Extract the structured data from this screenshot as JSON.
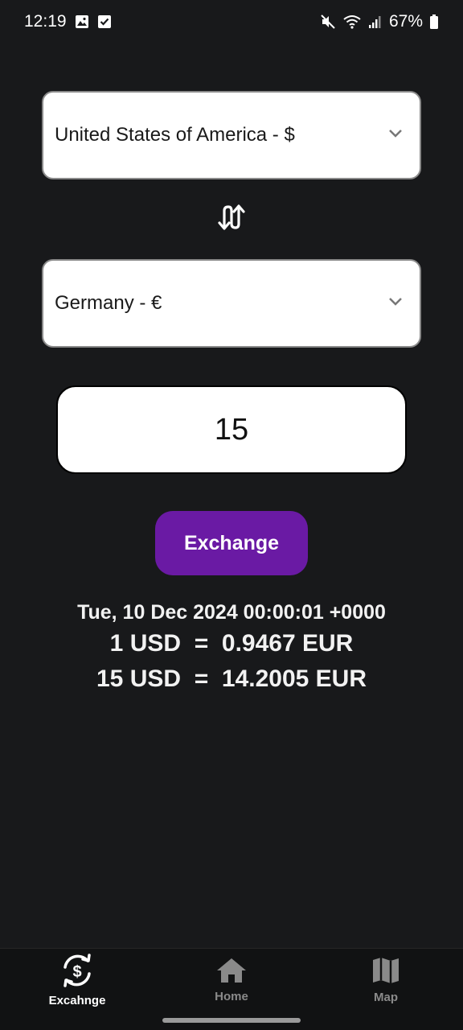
{
  "status_bar": {
    "time": "12:19",
    "battery": "67%",
    "left_icons": [
      "gallery-icon",
      "checkbox-icon"
    ],
    "right_icons": [
      "mute-icon",
      "wifi-icon",
      "signal-icon",
      "battery-icon"
    ]
  },
  "converter": {
    "from_currency": "United States of America - $",
    "to_currency": "Germany - €",
    "amount": "15",
    "exchange_label": "Exchange",
    "swap_icon": "swap-vertical-icon"
  },
  "result": {
    "date": "Tue, 10 Dec 2024 00:00:01 +0000",
    "rate_line": "1 USD  =  0.9467 EUR",
    "converted_line": "15 USD  =  14.2005 EUR"
  },
  "nav": {
    "items": [
      {
        "label": "Excahnge",
        "icon": "currency-exchange-icon",
        "active": true
      },
      {
        "label": "Home",
        "icon": "home-icon",
        "active": false
      },
      {
        "label": "Map",
        "icon": "map-icon",
        "active": false
      }
    ]
  },
  "colors": {
    "background": "#18191b",
    "accent": "#6a1aa4",
    "nav_background": "#111213",
    "nav_inactive": "#8a8a8a"
  }
}
